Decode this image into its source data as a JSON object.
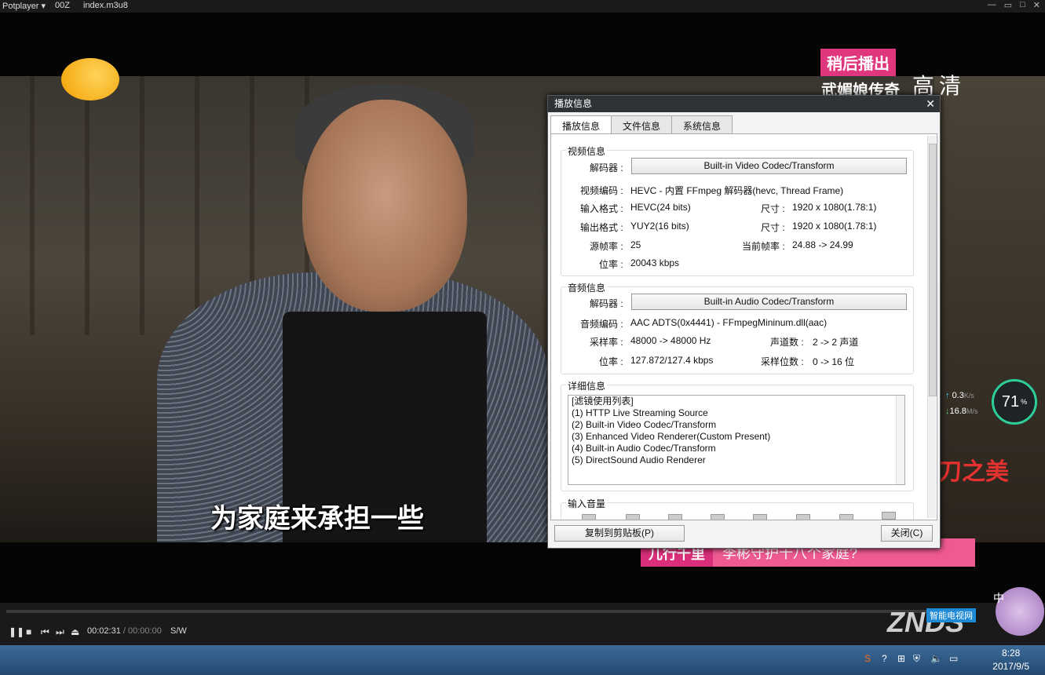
{
  "titlebar": {
    "app": "Potplayer ▾",
    "item2": "00Z",
    "file": "index.m3u8",
    "min": "—",
    "restore": "▭",
    "max": "□",
    "close": "✕"
  },
  "overlay": {
    "later_badge": "稍后播出",
    "show_name": "武媚娘传奇",
    "hd": "高清",
    "subtitle": "为家庭来承担一些",
    "calligraphy": "刀之美",
    "banner_a": "儿行千里",
    "banner_b": "李彬守护十八个家庭?",
    "net_up": "0.3",
    "net_up_unit": "K/s",
    "net_down": "16.8",
    "net_down_unit": "M/s",
    "cpu_value": "71",
    "cpu_unit": "%"
  },
  "dialog": {
    "title": "播放信息",
    "close": "✕",
    "tabs": [
      "播放信息",
      "文件信息",
      "系统信息"
    ],
    "video": {
      "group": "视频信息",
      "decoder_label": "解码器 :",
      "decoder_btn": "Built-in Video Codec/Transform",
      "codec_label": "视频编码 :",
      "codec_val": "HEVC - 内置 FFmpeg 解码器(hevc, Thread Frame)",
      "in_fmt_label": "输入格式 :",
      "in_fmt_val": "HEVC(24 bits)",
      "in_size_label": "尺寸 :",
      "in_size_val": "1920 x 1080(1.78:1)",
      "out_fmt_label": "输出格式 :",
      "out_fmt_val": "YUY2(16 bits)",
      "out_size_label": "尺寸 :",
      "out_size_val": "1920 x 1080(1.78:1)",
      "src_fps_label": "源帧率 :",
      "src_fps_val": "25",
      "cur_fps_label": "当前帧率 :",
      "cur_fps_val": "24.88 -> 24.99",
      "bitrate_label": "位率 :",
      "bitrate_val": "20043 kbps"
    },
    "audio": {
      "group": "音频信息",
      "decoder_label": "解码器 :",
      "decoder_btn": "Built-in Audio Codec/Transform",
      "codec_label": "音频编码 :",
      "codec_val": "AAC ADTS(0x4441) - FFmpegMininum.dll(aac)",
      "rate_label": "采样率 :",
      "rate_val": "48000 -> 48000 Hz",
      "ch_label": "声道数 :",
      "ch_val": "2 -> 2 声道",
      "bitrate_label": "位率 :",
      "bitrate_val": "127.872/127.4 kbps",
      "bits_label": "采样位数 :",
      "bits_val": "0 -> 16 位"
    },
    "detail": {
      "group": "详细信息",
      "lines": [
        "[滤镜使用列表]",
        "(1) HTTP Live Streaming Source",
        "(2) Built-in Video Codec/Transform",
        "(3) Enhanced Video Renderer(Custom Present)",
        "(4) Built-in Audio Codec/Transform",
        "(5) DirectSound Audio Renderer"
      ]
    },
    "volume": {
      "group": "输入音量"
    },
    "copy_btn": "复制到剪贴板(P)",
    "close_btn": "关闭(C)"
  },
  "player": {
    "time_current": "00:02:31",
    "time_sep": " / ",
    "time_total": "00:00:00",
    "mode": "S/W"
  },
  "watermark": {
    "brand": "ZNDS",
    "tag": "智能电视网",
    "ime": "中"
  },
  "taskbar": {
    "time": "8:28",
    "date": "2017/9/5"
  }
}
